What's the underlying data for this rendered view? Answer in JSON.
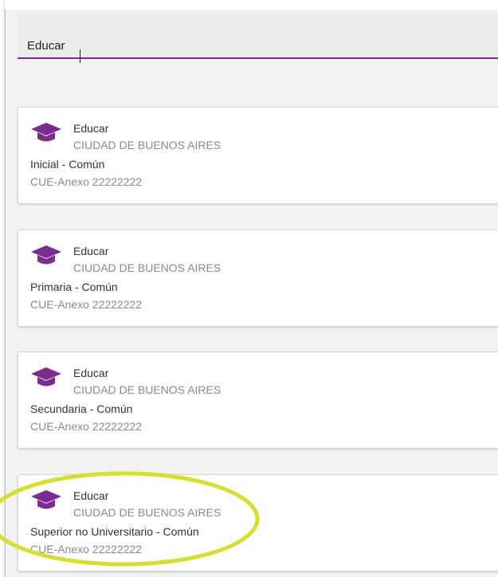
{
  "search": {
    "value": "Educar"
  },
  "colors": {
    "accent": "#7b2c8e",
    "highlight": "#d4e02a"
  },
  "icon": "graduation-cap-icon",
  "results": [
    {
      "name": "Educar",
      "city": "CIUDAD DE BUENOS AIRES",
      "level": "Inicial - Común",
      "cue": "CUE-Anexo 22222222"
    },
    {
      "name": "Educar",
      "city": "CIUDAD DE BUENOS AIRES",
      "level": "Primaria - Común",
      "cue": "CUE-Anexo 22222222"
    },
    {
      "name": "Educar",
      "city": "CIUDAD DE BUENOS AIRES",
      "level": "Secundaria - Común",
      "cue": "CUE-Anexo 22222222"
    },
    {
      "name": "Educar",
      "city": "CIUDAD DE BUENOS AIRES",
      "level": "Superior no Universitario - Común",
      "cue": "CUE-Anexo 22222222"
    }
  ]
}
